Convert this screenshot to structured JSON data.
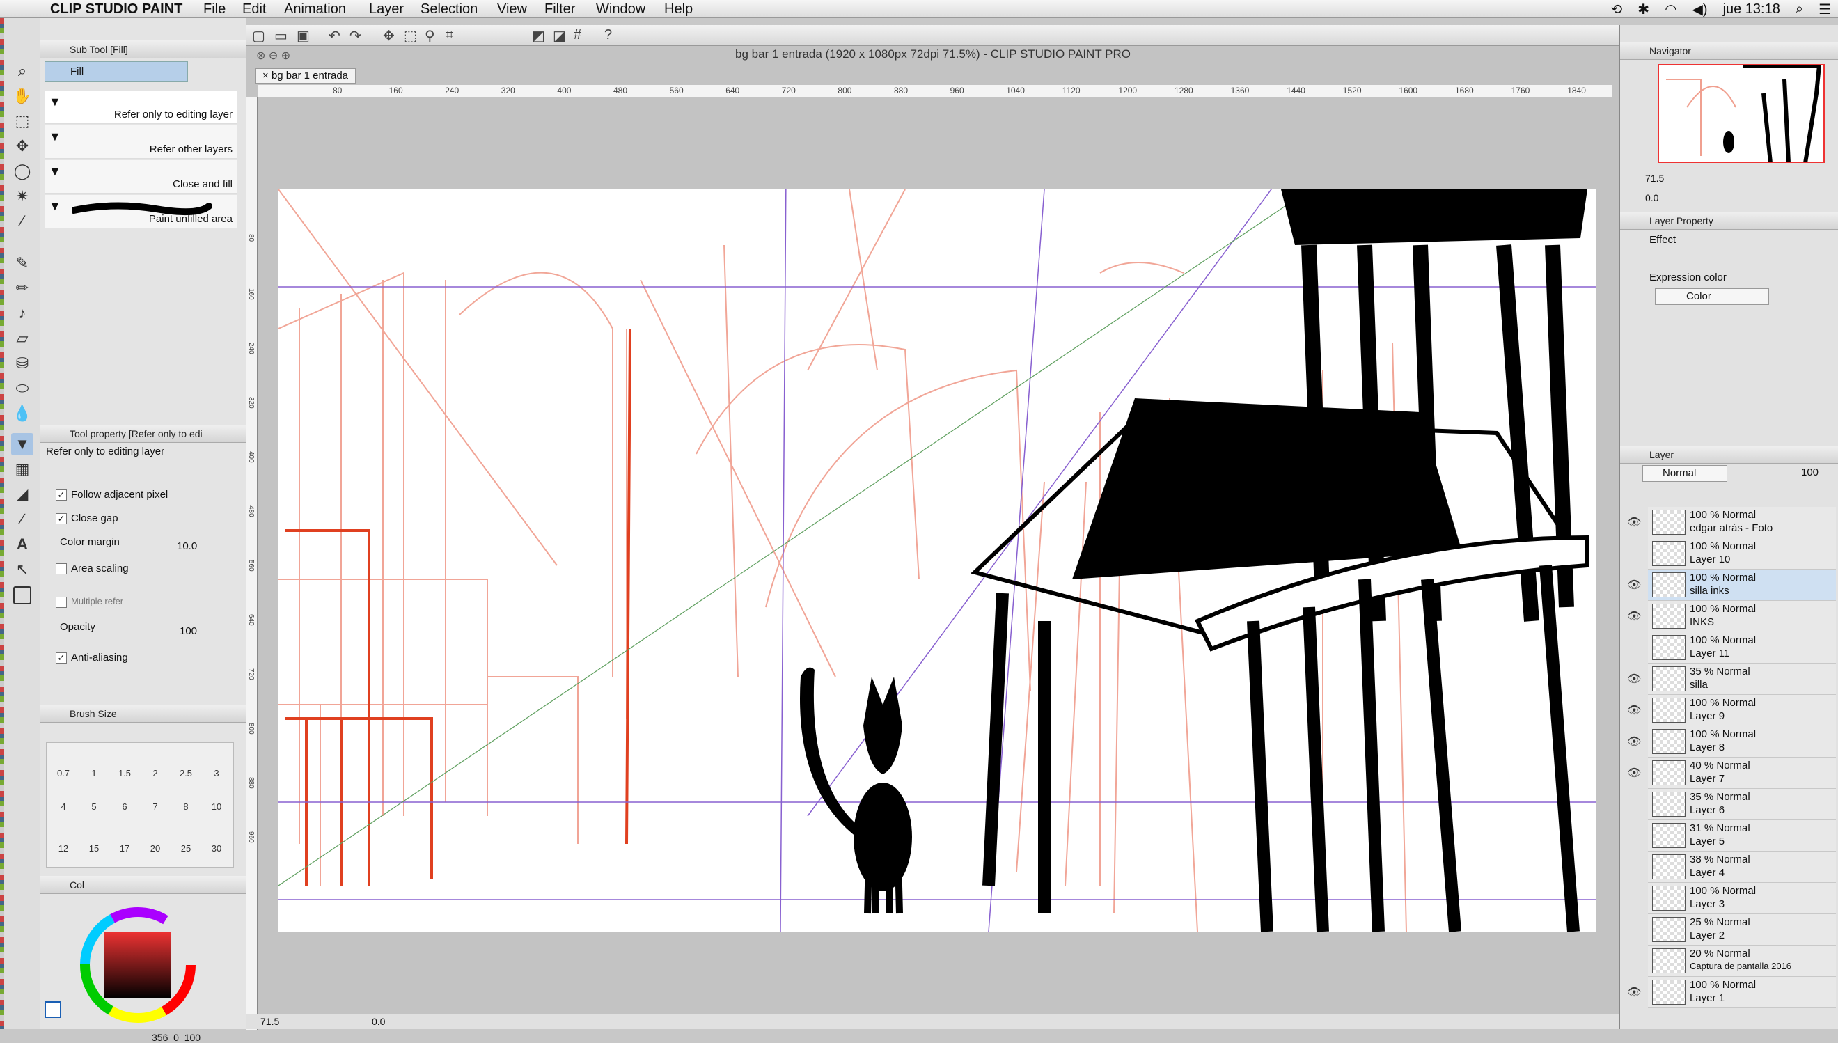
{
  "menubar": {
    "apple": "",
    "app_name": "CLIP STUDIO PAINT",
    "items": [
      "File",
      "Edit",
      "Animation",
      "Layer",
      "Selection",
      "View",
      "Filter",
      "Window",
      "Help"
    ],
    "clock": "jue 13:18"
  },
  "window": {
    "title": "bg bar 1 entrada (1920 x 1080px 72dpi 71.5%)  - CLIP STUDIO PAINT PRO",
    "doc_tab": "bg bar 1 entrada"
  },
  "subtool": {
    "header": "Sub Tool [Fill]",
    "group": "Fill",
    "items": [
      "Refer only to editing layer",
      "Refer other layers",
      "Close and fill",
      "Paint unfilled area"
    ]
  },
  "toolprop": {
    "header": "Tool property [Refer only to edi",
    "title": "Refer only to editing layer",
    "follow": "Follow adjacent pixel",
    "close_gap": "Close gap",
    "color_margin": "Color margin",
    "color_margin_val": "10.0",
    "area_scaling": "Area scaling",
    "multiple": "Multiple refer",
    "opacity": "Opacity",
    "opacity_val": "100",
    "anti": "Anti-aliasing"
  },
  "brushsize": {
    "header": "Brush Size",
    "sizes": [
      "0.7",
      "1",
      "1.5",
      "2",
      "2.5",
      "3",
      "4",
      "5",
      "6",
      "7",
      "8",
      "10",
      "12",
      "15",
      "17",
      "20",
      "25",
      "30"
    ]
  },
  "color": {
    "tab": "Col",
    "main": "#ffffff",
    "sub": "#1a5fb4",
    "status_left": "356",
    "status_mid": "0",
    "status_right": "100"
  },
  "ruler": {
    "ticks": [
      "80",
      "160",
      "240",
      "320",
      "400",
      "480",
      "560",
      "640",
      "720",
      "800",
      "880",
      "960",
      "1040",
      "1120",
      "1200",
      "1280",
      "1360",
      "1440",
      "1520",
      "1600",
      "1680",
      "1760",
      "1840"
    ],
    "vticks": [
      "80",
      "160",
      "240",
      "320",
      "400",
      "480",
      "560",
      "640",
      "720",
      "800",
      "880",
      "960"
    ]
  },
  "status": {
    "zoom": "71.5",
    "angle": "0.0"
  },
  "navigator": {
    "header": "Navigator",
    "zoom": "71.5",
    "angle": "0.0"
  },
  "layerprop": {
    "header": "Layer Property",
    "effect": "Effect",
    "expr": "Expression color",
    "expr_val": "Color"
  },
  "layer": {
    "header": "Layer",
    "blend": "Normal",
    "opacity": "100",
    "rows": [
      {
        "pct": "100 % Normal",
        "name": "edgar atrás - Foto",
        "eye": true
      },
      {
        "pct": "100 % Normal",
        "name": "Layer 10",
        "eye": false
      },
      {
        "pct": "100 % Normal",
        "name": "silla inks",
        "eye": true,
        "sel": true
      },
      {
        "pct": "100 % Normal",
        "name": "INKS",
        "eye": true
      },
      {
        "pct": "100 % Normal",
        "name": "Layer 11",
        "eye": false
      },
      {
        "pct": "35 % Normal",
        "name": "silla",
        "eye": true
      },
      {
        "pct": "100 % Normal",
        "name": "Layer 9",
        "eye": true
      },
      {
        "pct": "100 % Normal",
        "name": "Layer 8",
        "eye": true
      },
      {
        "pct": "40 % Normal",
        "name": "Layer 7",
        "eye": true
      },
      {
        "pct": "35 % Normal",
        "name": "Layer 6",
        "eye": false
      },
      {
        "pct": "31 % Normal",
        "name": "Layer 5",
        "eye": false
      },
      {
        "pct": "38 % Normal",
        "name": "Layer 4",
        "eye": false
      },
      {
        "pct": "100 % Normal",
        "name": "Layer 3",
        "eye": false
      },
      {
        "pct": "25 % Normal",
        "name": "Layer 2",
        "eye": false
      },
      {
        "pct": "20 % Normal",
        "name": "Captura de pantalla 2016",
        "eye": false
      },
      {
        "pct": "100 % Normal",
        "name": "Layer 1",
        "eye": true
      }
    ]
  }
}
